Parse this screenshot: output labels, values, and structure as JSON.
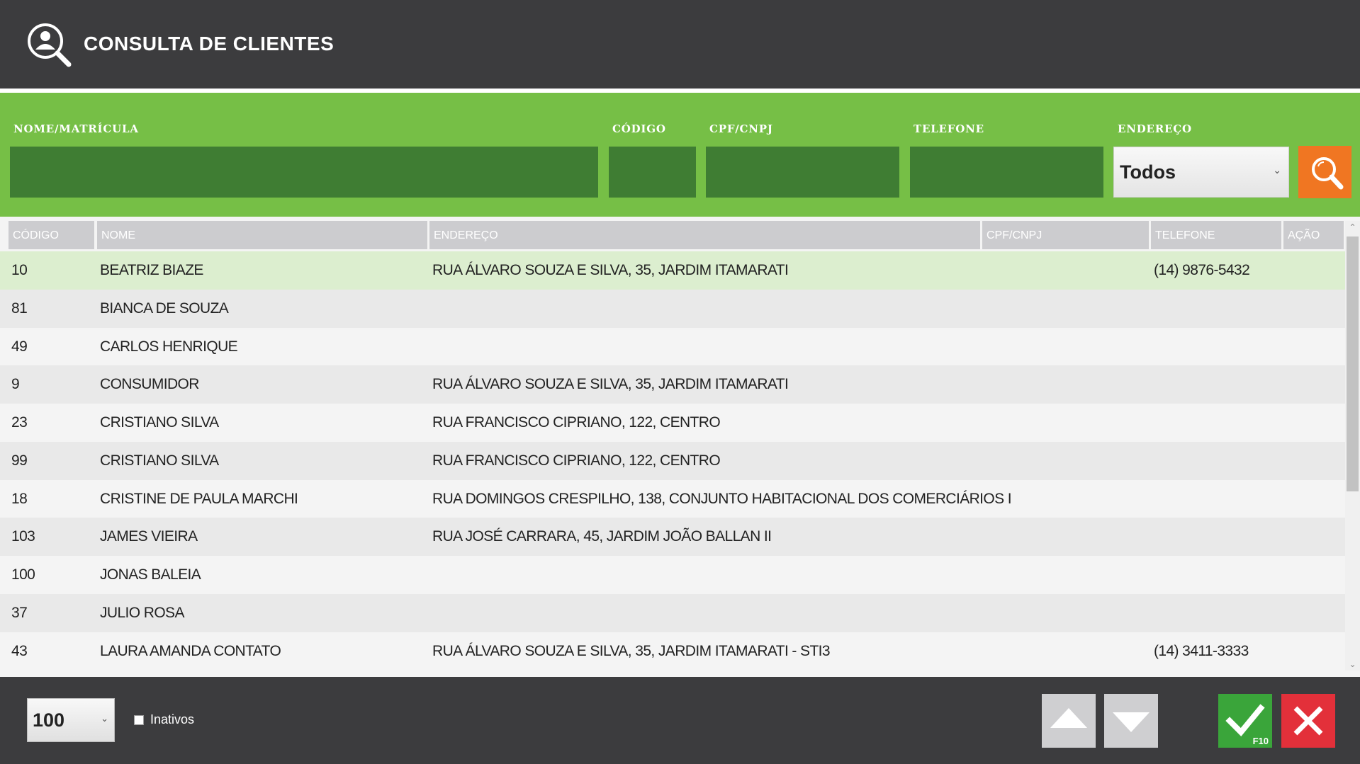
{
  "header": {
    "title": "CONSULTA DE CLIENTES",
    "icon": "user-search-icon"
  },
  "filters": {
    "nome_label": "NOME/MATRÍCULA",
    "codigo_label": "CÓDIGO",
    "cpf_label": "CPF/CNPJ",
    "telefone_label": "TELEFONE",
    "endereco_label": "ENDEREÇO",
    "nome_value": "",
    "codigo_value": "",
    "cpf_value": "",
    "telefone_value": "",
    "endereco_selected": "Todos",
    "search_icon": "search-icon"
  },
  "table": {
    "columns": [
      "CÓDIGO",
      "NOME",
      "ENDEREÇO",
      "CPF/CNPJ",
      "TELEFONE",
      "AÇÃO"
    ],
    "rows": [
      {
        "codigo": "10",
        "nome": "BEATRIZ BIAZE",
        "endereco": "RUA ÁLVARO SOUZA E SILVA, 35, JARDIM ITAMARATI",
        "cpf": "",
        "telefone": "(14) 9876-5432",
        "selected": true
      },
      {
        "codigo": "81",
        "nome": "BIANCA DE SOUZA",
        "endereco": "",
        "cpf": "",
        "telefone": ""
      },
      {
        "codigo": "49",
        "nome": "CARLOS HENRIQUE",
        "endereco": "",
        "cpf": "",
        "telefone": ""
      },
      {
        "codigo": "9",
        "nome": "CONSUMIDOR",
        "endereco": "RUA ÁLVARO SOUZA E SILVA, 35, JARDIM ITAMARATI",
        "cpf": "",
        "telefone": ""
      },
      {
        "codigo": "23",
        "nome": "CRISTIANO SILVA",
        "endereco": "RUA FRANCISCO CIPRIANO, 122, CENTRO",
        "cpf": "",
        "telefone": ""
      },
      {
        "codigo": "99",
        "nome": "CRISTIANO SILVA",
        "endereco": "RUA FRANCISCO CIPRIANO, 122, CENTRO",
        "cpf": "",
        "telefone": ""
      },
      {
        "codigo": "18",
        "nome": "CRISTINE DE PAULA MARCHI",
        "endereco": "RUA DOMINGOS CRESPILHO, 138, CONJUNTO HABITACIONAL DOS COMERCIÁRIOS I",
        "cpf": "",
        "telefone": ""
      },
      {
        "codigo": "103",
        "nome": "JAMES VIEIRA",
        "endereco": "RUA JOSÉ CARRARA, 45, JARDIM JOÃO BALLAN II",
        "cpf": "",
        "telefone": ""
      },
      {
        "codigo": "100",
        "nome": "JONAS BALEIA",
        "endereco": "",
        "cpf": "",
        "telefone": ""
      },
      {
        "codigo": "37",
        "nome": "JULIO ROSA",
        "endereco": "",
        "cpf": "",
        "telefone": ""
      },
      {
        "codigo": "43",
        "nome": "LAURA AMANDA CONTATO",
        "endereco": "RUA ÁLVARO SOUZA E SILVA, 35, JARDIM ITAMARATI - STI3",
        "cpf": "",
        "telefone": "(14) 3411-3333"
      }
    ]
  },
  "footer": {
    "page_size": "100",
    "inativos_label": "Inativos",
    "inativos_checked": false,
    "up_icon": "arrow-up-icon",
    "down_icon": "arrow-down-icon",
    "confirm_icon": "checkmark-icon",
    "confirm_shortcut": "F10",
    "cancel_icon": "close-icon"
  },
  "colors": {
    "header_bg": "#3c3c3e",
    "filter_bg": "#76bf46",
    "input_bg": "#3f7d33",
    "search_btn": "#f07622",
    "selected_row": "#dceecf",
    "confirm_btn": "#3aa53a",
    "cancel_btn": "#e3303a"
  }
}
